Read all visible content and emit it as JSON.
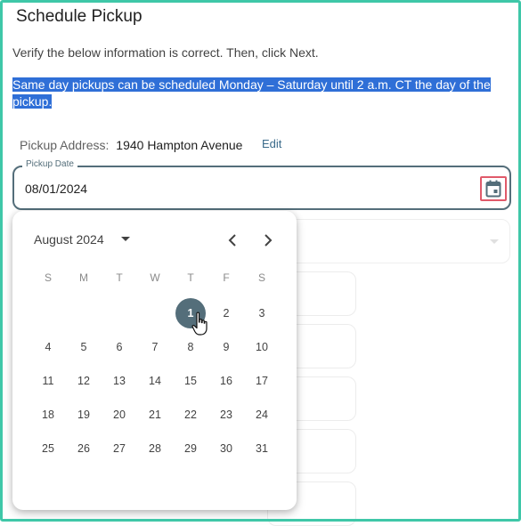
{
  "page": {
    "title": "Schedule Pickup",
    "instructions": "Verify the below information is correct. Then, click Next.",
    "notice": "Same day pickups can be scheduled Monday – Saturday until 2 a.m. CT the day of the pickup."
  },
  "address": {
    "label": "Pickup Address:",
    "value": "1940 Hampton Avenue",
    "edit_label": "Edit"
  },
  "date_field": {
    "label": "Pickup Date",
    "value": "08/01/2024",
    "icon": "calendar-icon"
  },
  "calendar": {
    "month_label": "August 2024",
    "weekdays": [
      "S",
      "M",
      "T",
      "W",
      "T",
      "F",
      "S"
    ],
    "weeks": [
      [
        "",
        "",
        "",
        "",
        "1",
        "2",
        "3"
      ],
      [
        "4",
        "5",
        "6",
        "7",
        "8",
        "9",
        "10"
      ],
      [
        "11",
        "12",
        "13",
        "14",
        "15",
        "16",
        "17"
      ],
      [
        "18",
        "19",
        "20",
        "21",
        "22",
        "23",
        "24"
      ],
      [
        "25",
        "26",
        "27",
        "28",
        "29",
        "30",
        "31"
      ]
    ],
    "selected_day": "1"
  },
  "colors": {
    "frame": "#3fc7a8",
    "selection_highlight": "#2f6fd7",
    "accent": "#546e7a",
    "calendar_button_outline": "#e05a6a"
  }
}
